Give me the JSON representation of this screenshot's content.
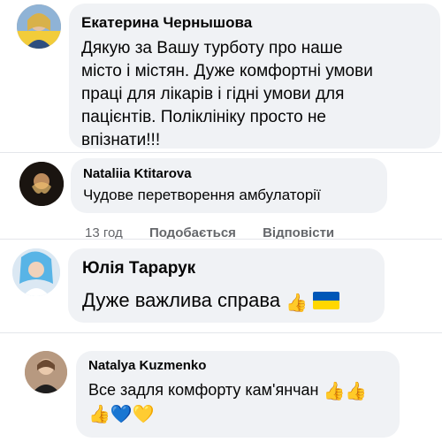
{
  "comments": [
    {
      "author": "Екатерина Чернышова",
      "lines": [
        "Дякую за Вашу турботу про наше",
        "місто і містян. Дуже комфортні умови",
        "праці для лікарів і гідні умови для",
        "пацієнтів.  Поліклініку просто не",
        "впізнати!!!"
      ]
    },
    {
      "author": "Nataliia Ktitarova",
      "text": "Чудове  перетворення амбулаторії",
      "time": "13 год",
      "like_label": "Подобається",
      "reply_label": "Відповісти"
    },
    {
      "author": "Юлія Тарарук",
      "text": "Дуже важлива справа"
    },
    {
      "author": "Natalya  Kuzmenko",
      "line1": "Все задля комфорту кам'янчан",
      "thumbs": "👍👍",
      "line2_emoji": "👍💙💛"
    }
  ],
  "colors": {
    "bubble_bg": "#f0f2f5",
    "meta_text": "#65676b",
    "flag_blue": "#0057b7",
    "flag_yellow": "#ffd700"
  },
  "icons": [
    "thumbs-up-emoji",
    "ukraine-flag-emoji",
    "blue-heart-emoji",
    "yellow-heart-emoji"
  ]
}
